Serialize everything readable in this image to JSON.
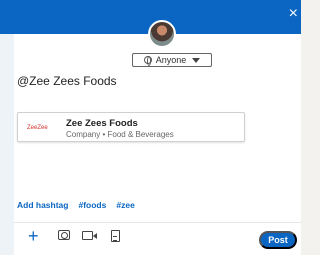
{
  "window": {
    "close_glyph": "×"
  },
  "audience": {
    "label": "Anyone",
    "icon": "globe-icon"
  },
  "mention": {
    "text": "@Zee Zees Foods"
  },
  "card": {
    "logo_text": "ZeeZee",
    "name": "Zee Zees Foods",
    "subtitle": "Company • Food & Beverages"
  },
  "hashtags": {
    "add_label": "Add hashtag",
    "tags": [
      "#foods",
      "#zee"
    ]
  },
  "toolbar": {
    "plus_glyph": "+",
    "post_label": "Post"
  },
  "colors": {
    "brand_blue": "#0a66c2",
    "text": "#222222",
    "muted": "#666666"
  }
}
